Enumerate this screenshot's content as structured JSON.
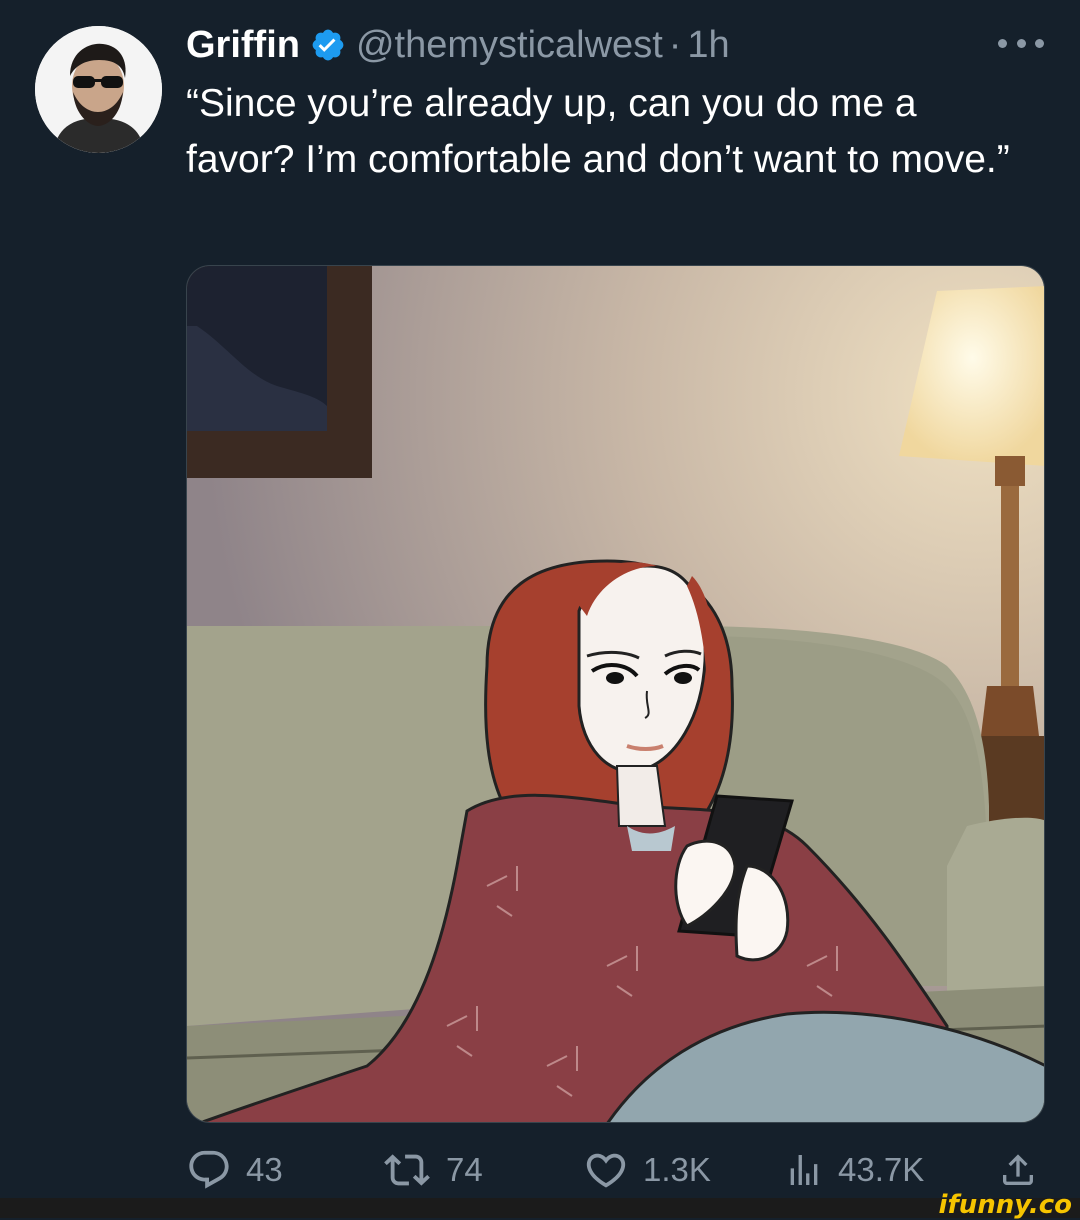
{
  "tweet": {
    "display_name": "Griffin",
    "verified": true,
    "handle": "@themysticalwest",
    "separator": "·",
    "time": "1h",
    "text": "“Since you’re already up, can you do me a favor? I’m comfortable and don’t want to move.”"
  },
  "actions": {
    "replies": "43",
    "retweets": "74",
    "likes": "1.3K",
    "views": "43.7K"
  },
  "watermark": "ifunny.co",
  "colors": {
    "background": "#15202b",
    "text": "#ffffff",
    "secondary": "#8b98a5",
    "verified": "#1d9bf0",
    "watermark": "#f6c400"
  },
  "icons": [
    "verified-badge-icon",
    "more-icon",
    "reply-icon",
    "retweet-icon",
    "like-icon",
    "views-icon",
    "share-icon"
  ]
}
